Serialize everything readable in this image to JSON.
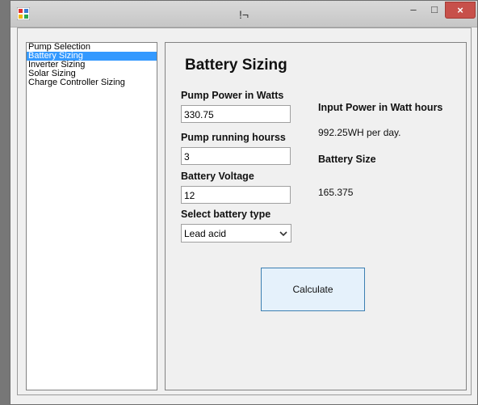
{
  "window": {
    "title": "!¬",
    "minimize_glyph": "–",
    "maximize_glyph": "□",
    "close_glyph": "×",
    "app_icon": "winforms-app-icon"
  },
  "sidebar": {
    "items": [
      {
        "label": "Pump Selection",
        "selected": false
      },
      {
        "label": "Battery Sizing",
        "selected": true
      },
      {
        "label": "Inverter Sizing",
        "selected": false
      },
      {
        "label": "Solar Sizing",
        "selected": false
      },
      {
        "label": "Charge Controller Sizing",
        "selected": false
      }
    ],
    "selected_color": "#3399ff"
  },
  "main": {
    "title": "Battery Sizing",
    "pump_power": {
      "label": "Pump Power in Watts",
      "value": "330.75"
    },
    "pump_hours": {
      "label": "Pump running hourss",
      "value": "3"
    },
    "battery_voltage": {
      "label": "Battery Voltage",
      "value": "12"
    },
    "battery_type": {
      "label": "Select battery type",
      "value": "Lead acid"
    },
    "calculate_label": "Calculate",
    "input_power": {
      "label": "Input Power in Watt hours",
      "value": "992.25WH per day."
    },
    "battery_size": {
      "label": "Battery Size",
      "value": "165.375"
    }
  }
}
